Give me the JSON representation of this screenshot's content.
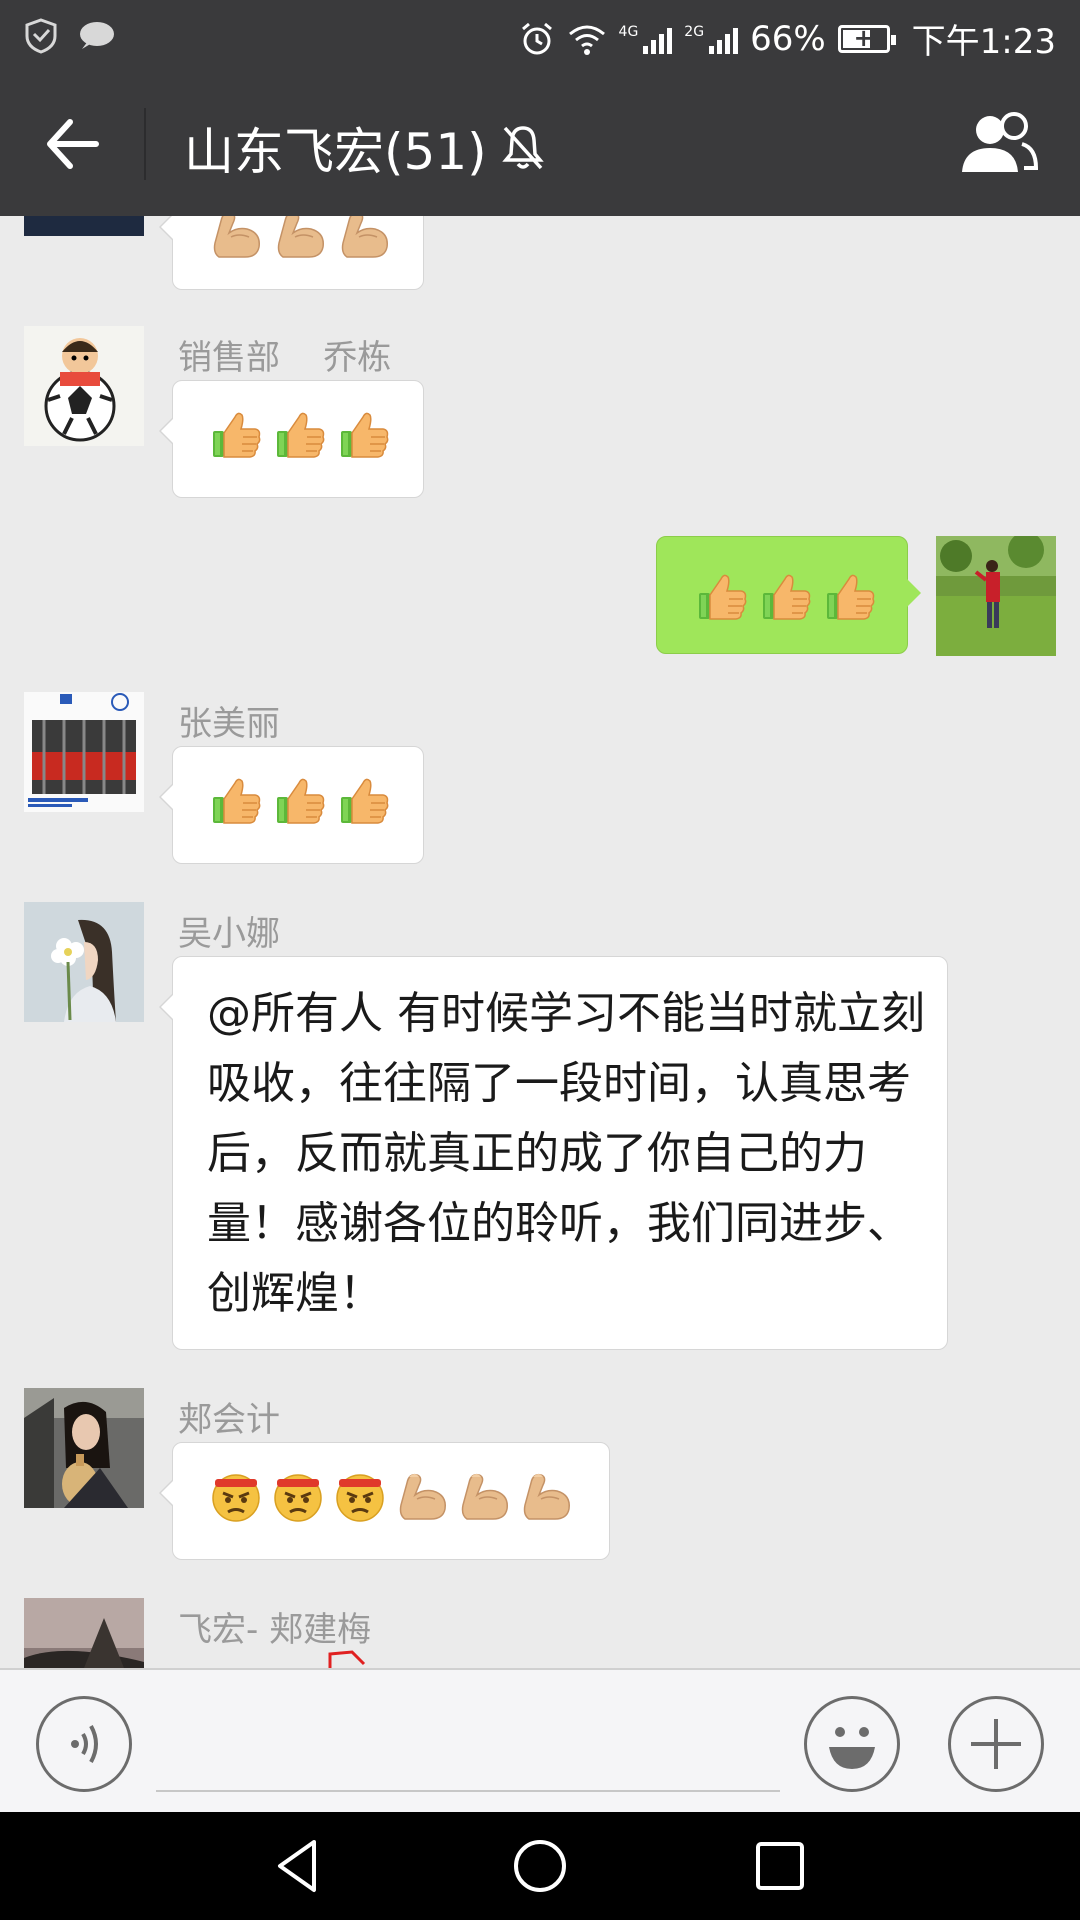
{
  "status_bar": {
    "network_4g": "4G",
    "network_2g": "2G",
    "battery": "66%",
    "battery_level": 0.66,
    "time": "下午1:23"
  },
  "header": {
    "title": "山东飞宏(51)"
  },
  "messages": [
    {
      "sender": "",
      "emojis": [
        "flexed-biceps",
        "flexed-biceps",
        "flexed-biceps"
      ]
    },
    {
      "sender": "销售部    乔栋",
      "emojis": [
        "thumbs-up",
        "thumbs-up",
        "thumbs-up"
      ]
    },
    {
      "sender": "",
      "emojis": [
        "thumbs-up",
        "thumbs-up",
        "thumbs-up"
      ],
      "outgoing": true
    },
    {
      "sender": "张美丽",
      "emojis": [
        "thumbs-up",
        "thumbs-up",
        "thumbs-up"
      ]
    },
    {
      "sender": "吴小娜",
      "text": "@所有人 有时候学习不能当时就立刻吸收，往往隔了一段时间，认真思考后，反而就真正的成了你自己的力量！感谢各位的聆听，我们同进步、创辉煌！"
    },
    {
      "sender": "郏会计",
      "emojis": [
        "angry-face",
        "angry-face",
        "angry-face",
        "flexed-biceps",
        "flexed-biceps",
        "flexed-biceps"
      ]
    },
    {
      "sender": "飞宏- 郏建梅",
      "emojis": []
    }
  ],
  "colors": {
    "bar_bg": "#3a3a3c",
    "chat_bg": "#ebebeb",
    "outgoing_bubble": "#9fe65a",
    "incoming_bubble": "#ffffff"
  }
}
